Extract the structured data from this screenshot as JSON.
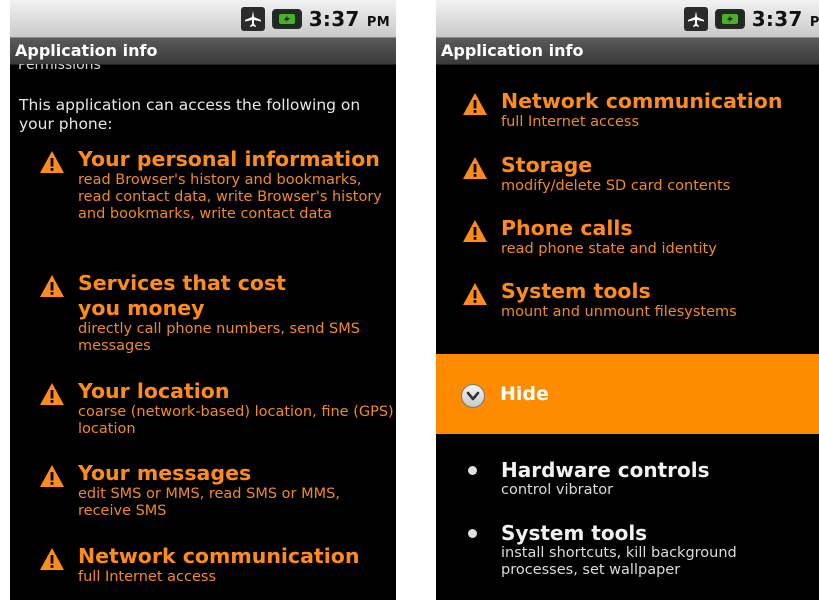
{
  "status": {
    "time": "3:37",
    "ampm": "PM",
    "right_time": "3:37",
    "right_ampm": "PM"
  },
  "title": "Application info",
  "left": {
    "cut_heading": "Permissions",
    "intro": "This application can access the following on your phone:",
    "permissions": [
      {
        "title": "Your personal information",
        "desc": "read Browser's history and bookmarks, read contact data, write Browser's history and bookmarks, write contact data"
      },
      {
        "title": "Services that cost you money",
        "desc": "directly call phone numbers, send SMS messages"
      },
      {
        "title": "Your location",
        "desc": "coarse (network-based) location, fine (GPS) location"
      },
      {
        "title": "Your messages",
        "desc": "edit SMS or MMS, read SMS or MMS, receive SMS"
      },
      {
        "title": "Network communication",
        "desc": "full Internet access"
      }
    ]
  },
  "right": {
    "permissions": [
      {
        "title": "Network communication",
        "desc": "full Internet access"
      },
      {
        "title": "Storage",
        "desc": "modify/delete SD card contents"
      },
      {
        "title": "Phone calls",
        "desc": "read phone state and identity"
      },
      {
        "title": "System tools",
        "desc": "mount and unmount filesystems"
      }
    ],
    "hide_label": "Hide",
    "normal_permissions": [
      {
        "title": "Hardware controls",
        "desc": "control vibrator"
      },
      {
        "title": "System tools",
        "desc": "install shortcuts, kill background processes, set wallpaper"
      }
    ]
  },
  "colors": {
    "accent": "#ff8c00",
    "warning_text": "#ff8c1a",
    "background": "#000000"
  },
  "icons": [
    "airplane-icon",
    "battery-icon",
    "warning-icon",
    "chevron-down-icon",
    "bullet-icon"
  ]
}
